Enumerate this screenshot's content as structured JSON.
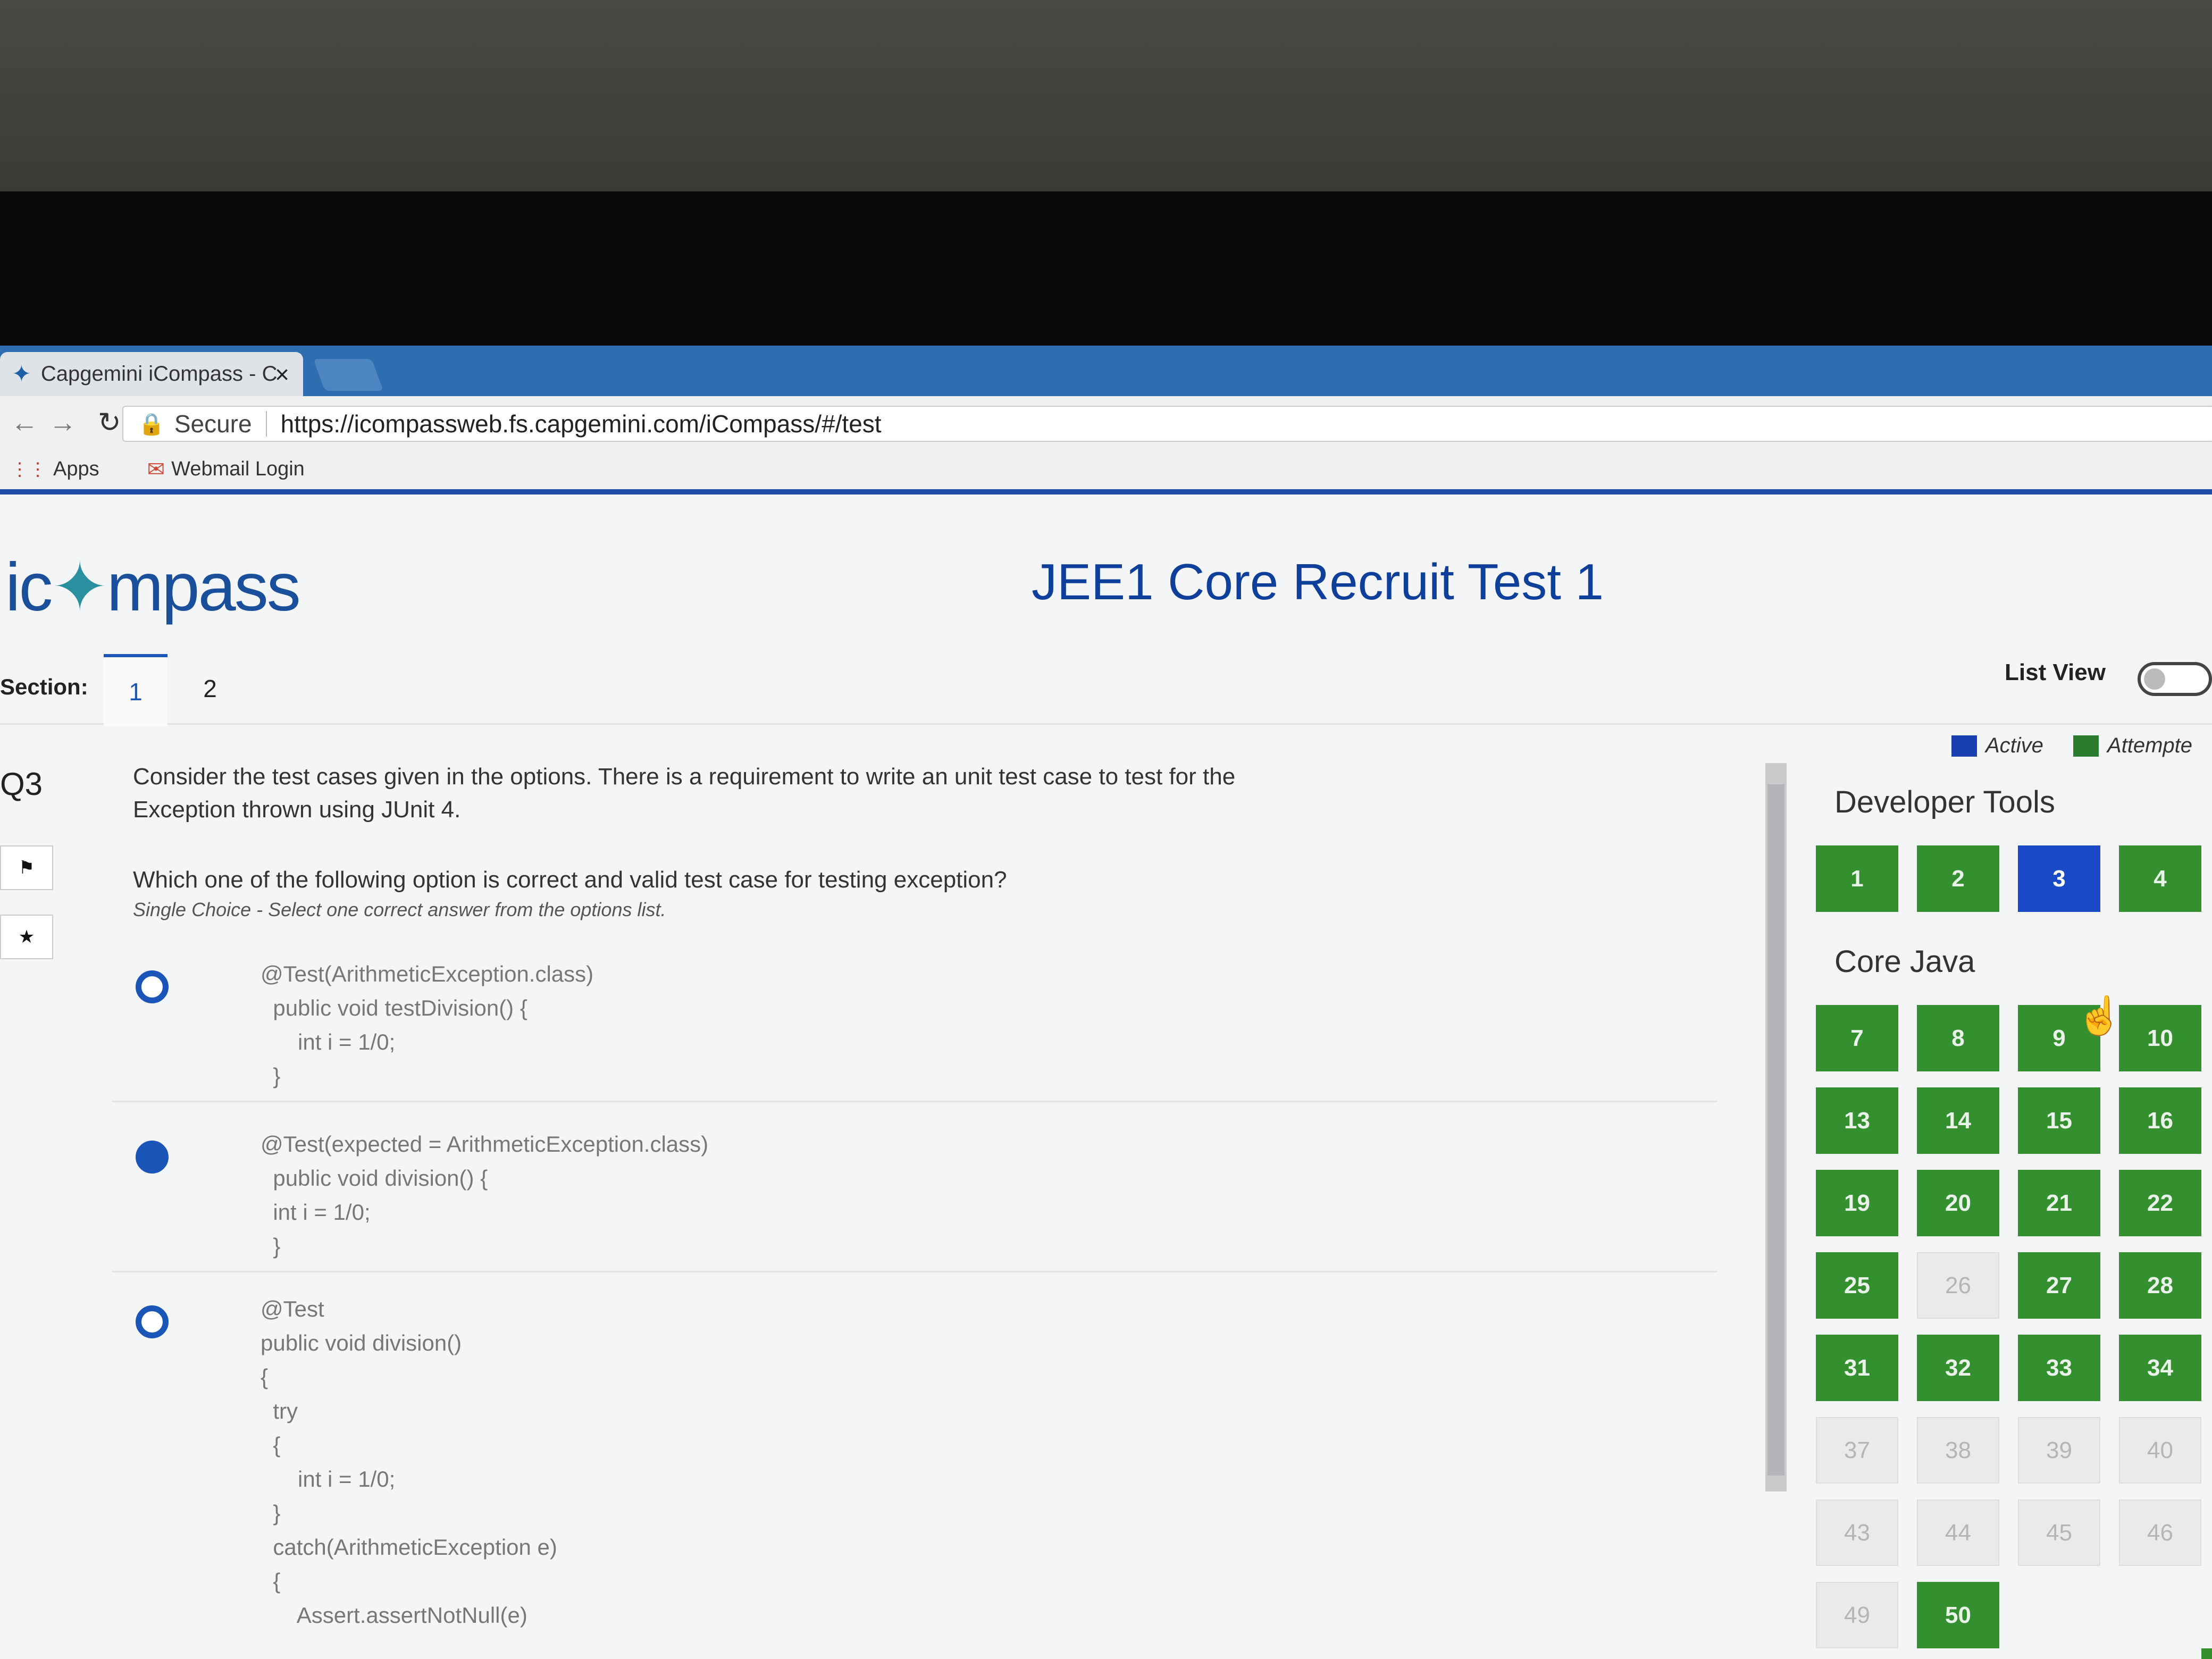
{
  "browser": {
    "tab_title": "Capgemini iCompass - C",
    "tab_close": "×",
    "secure_label": "Secure",
    "url": "https://icompassweb.fs.capgemini.com/iCompass/#/test",
    "bookmarks": [
      "Apps",
      "Webmail Login"
    ]
  },
  "header": {
    "logo_left": "ic",
    "logo_right": "mpass",
    "title": "JEE1 Core Recruit Test 1"
  },
  "sections": {
    "label": "Section:",
    "tabs": [
      "1",
      "2"
    ],
    "active": "1"
  },
  "list_view": {
    "label": "List View",
    "on": false
  },
  "legend": {
    "active": "Active",
    "attempted": "Attempte"
  },
  "question": {
    "number": "Q3",
    "text": "Consider the test cases given in the options. There is a requirement to write an unit test case to test for the Exception thrown using JUnit 4.",
    "prompt": "Which one of the following option is correct and valid test case for testing exception?",
    "hint": "Single Choice - Select one correct answer from the options list.",
    "options": [
      {
        "selected": false,
        "lines": [
          "@Test(ArithmeticException.class)",
          "  public void testDivision() {",
          "      int i = 1/0;",
          "  }"
        ]
      },
      {
        "selected": true,
        "lines": [
          "@Test(expected = ArithmeticException.class)",
          "  public void division() {",
          "  int i = 1/0;",
          "  }"
        ]
      },
      {
        "selected": false,
        "lines": [
          "@Test",
          "public void division()",
          "{",
          "  try",
          "  {",
          "      int i = 1/0;",
          "  }",
          "  catch(ArithmeticException e)",
          "  {",
          "      Assert.assertNotNull(e)"
        ]
      }
    ]
  },
  "palette": {
    "groups": [
      {
        "name": "Developer Tools",
        "items": [
          {
            "n": "1",
            "s": "att"
          },
          {
            "n": "2",
            "s": "att"
          },
          {
            "n": "3",
            "s": "act"
          },
          {
            "n": "4",
            "s": "att"
          }
        ]
      },
      {
        "name": "Core Java",
        "items": [
          {
            "n": "7",
            "s": "att"
          },
          {
            "n": "8",
            "s": "att"
          },
          {
            "n": "9",
            "s": "att"
          },
          {
            "n": "10",
            "s": "att"
          },
          {
            "n": "13",
            "s": "att"
          },
          {
            "n": "14",
            "s": "att"
          },
          {
            "n": "15",
            "s": "att"
          },
          {
            "n": "16",
            "s": "att"
          },
          {
            "n": "19",
            "s": "att"
          },
          {
            "n": "20",
            "s": "att"
          },
          {
            "n": "21",
            "s": "att"
          },
          {
            "n": "22",
            "s": "att"
          },
          {
            "n": "25",
            "s": "att"
          },
          {
            "n": "26",
            "s": "un"
          },
          {
            "n": "27",
            "s": "att"
          },
          {
            "n": "28",
            "s": "att"
          },
          {
            "n": "31",
            "s": "att"
          },
          {
            "n": "32",
            "s": "att"
          },
          {
            "n": "33",
            "s": "att"
          },
          {
            "n": "34",
            "s": "att"
          },
          {
            "n": "37",
            "s": "un"
          },
          {
            "n": "38",
            "s": "un"
          },
          {
            "n": "39",
            "s": "un"
          },
          {
            "n": "40",
            "s": "un"
          },
          {
            "n": "43",
            "s": "un"
          },
          {
            "n": "44",
            "s": "un"
          },
          {
            "n": "45",
            "s": "un"
          },
          {
            "n": "46",
            "s": "un"
          },
          {
            "n": "49",
            "s": "un"
          },
          {
            "n": "50",
            "s": "att"
          }
        ]
      }
    ]
  },
  "colors": {
    "accent": "#1a55b8",
    "attempted": "#34902f",
    "active": "#1a49c8",
    "tabstrip": "#2f6db1"
  },
  "icons": {
    "tab": "compass-icon",
    "lock": "lock-icon",
    "flag": "flag-icon",
    "bookmark": "star-icon",
    "cursor": "hand-pointer-icon"
  }
}
